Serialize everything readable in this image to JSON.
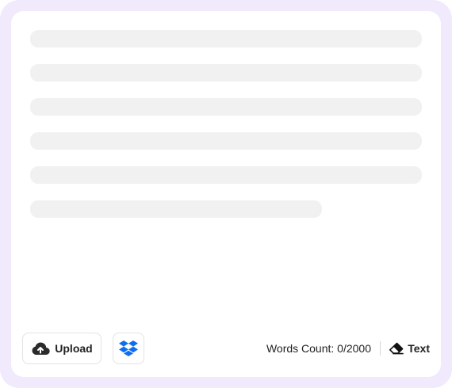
{
  "editor": {
    "placeholder_lines": 6,
    "loading": true
  },
  "toolbar": {
    "upload_label": "Upload",
    "upload_icon": "cloud-upload-icon",
    "dropbox_icon": "dropbox-icon",
    "words_count_label": "Words Count: 0/2000",
    "clear_label": "Text",
    "clear_icon": "eraser-icon"
  },
  "colors": {
    "frame": "#f1eafd",
    "skeleton": "#f1f1f1",
    "dropbox_blue": "#0d6ff0"
  }
}
